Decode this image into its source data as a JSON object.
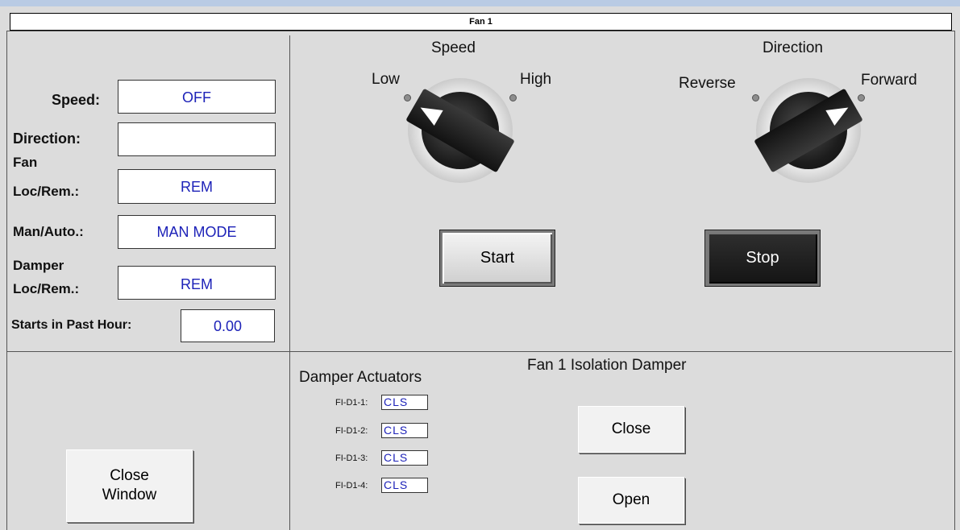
{
  "window": {
    "title": "Fan 1"
  },
  "status_panel": {
    "speed_label": "Speed:",
    "speed_value": "OFF",
    "direction_label": "Direction:",
    "direction_value": "",
    "fan_locrem_label_1": "Fan",
    "fan_locrem_label_2": "Loc/Rem.:",
    "fan_locrem_value": "REM",
    "manauto_label": "Man/Auto.:",
    "manauto_value": "MAN MODE",
    "damper_locrem_label_1": "Damper",
    "damper_locrem_label_2": "Loc/Rem.:",
    "damper_locrem_value": "REM",
    "starts_label": "Starts in Past Hour:",
    "starts_value": "0.00"
  },
  "speed_selector": {
    "title": "Speed",
    "left_label": "Low",
    "right_label": "High",
    "position": "Low"
  },
  "direction_selector": {
    "title": "Direction",
    "left_label": "Reverse",
    "right_label": "Forward",
    "position": "Forward"
  },
  "buttons": {
    "start": "Start",
    "stop": "Stop",
    "close_window_1": "Close",
    "close_window_2": "Window"
  },
  "damper": {
    "section_title": "Fan 1 Isolation Damper",
    "actuators_title": "Damper Actuators",
    "actuators": [
      {
        "label": "FI-D1-1:",
        "value": "CLS"
      },
      {
        "label": "FI-D1-2:",
        "value": "CLS"
      },
      {
        "label": "FI-D1-3:",
        "value": "CLS"
      },
      {
        "label": "FI-D1-4:",
        "value": "CLS"
      }
    ],
    "close_button": "Close",
    "open_button": "Open"
  },
  "icons": [
    "selector-knob-icon",
    "indicator-dot-icon"
  ]
}
